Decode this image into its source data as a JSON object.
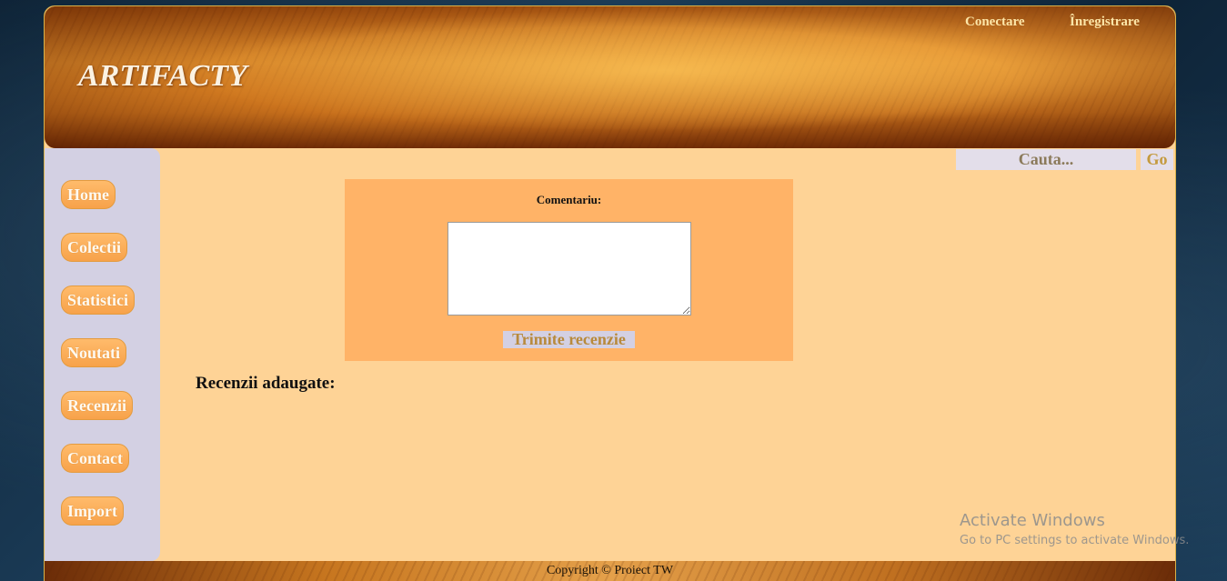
{
  "header": {
    "site_title": "ARTIFACTY",
    "login_link": "Conectare",
    "register_link": "Înregistrare"
  },
  "search": {
    "placeholder": "Cauta...",
    "button_label": "Go"
  },
  "sidebar": {
    "items": [
      {
        "label": "Home"
      },
      {
        "label": "Colectii"
      },
      {
        "label": "Statistici"
      },
      {
        "label": "Noutati"
      },
      {
        "label": "Recenzii"
      },
      {
        "label": "Contact"
      },
      {
        "label": "Import"
      }
    ]
  },
  "review_form": {
    "comment_label": "Comentariu:",
    "comment_value": "",
    "submit_label": "Trimite recenzie"
  },
  "reviews": {
    "heading": "Recenzii adaugate:"
  },
  "footer": {
    "copyright": "Copyright © Proiect TW"
  },
  "watermark": {
    "title": "Activate Windows",
    "subtitle": "Go to PC settings to activate Windows."
  },
  "colors": {
    "page_background": "#fed396",
    "sidebar": "#d3d0e3",
    "nav_button": "#f7a24a",
    "form_box": "#ffb367",
    "search_box": "#e3deea",
    "title_text": "#fbf2e2"
  }
}
